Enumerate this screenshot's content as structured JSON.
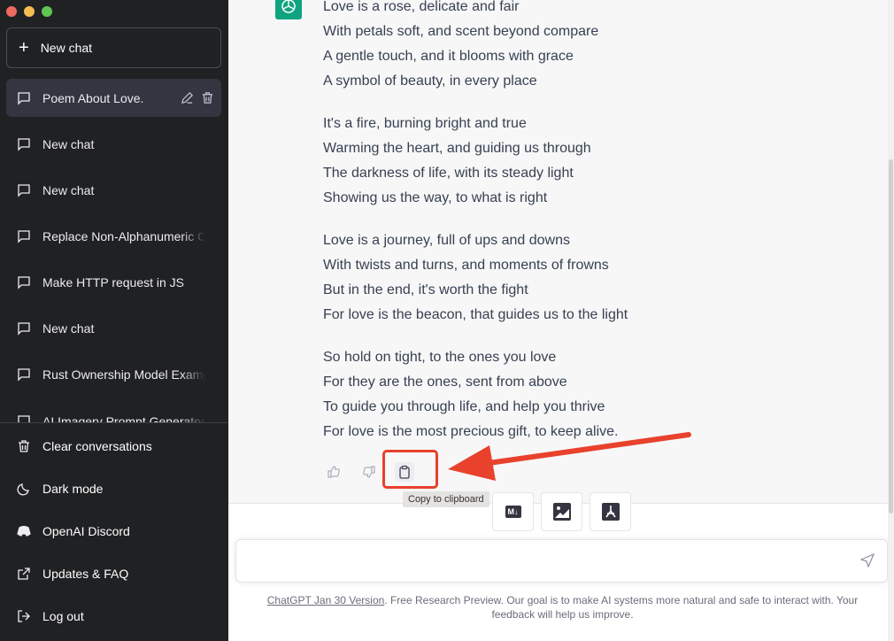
{
  "sidebar": {
    "new_chat": "New chat",
    "conversations": [
      {
        "label": "Poem About Love.",
        "active": true
      },
      {
        "label": "New chat"
      },
      {
        "label": "New chat"
      },
      {
        "label": "Replace Non-Alphanumeric Characters"
      },
      {
        "label": "Make HTTP request in JS"
      },
      {
        "label": "New chat"
      },
      {
        "label": "Rust Ownership Model Example"
      },
      {
        "label": "AI Imagery Prompt Generator"
      }
    ],
    "bottom": [
      {
        "label": "Clear conversations",
        "icon": "trash-icon"
      },
      {
        "label": "Dark mode",
        "icon": "moon-icon"
      },
      {
        "label": "OpenAI Discord",
        "icon": "discord-icon"
      },
      {
        "label": "Updates & FAQ",
        "icon": "external-link-icon"
      },
      {
        "label": "Log out",
        "icon": "logout-icon"
      }
    ]
  },
  "message": {
    "stanzas": [
      [
        "Love is a rose, delicate and fair",
        "With petals soft, and scent beyond compare",
        "A gentle touch, and it blooms with grace",
        "A symbol of beauty, in every place"
      ],
      [
        "It's a fire, burning bright and true",
        "Warming the heart, and guiding us through",
        "The darkness of life, with its steady light",
        "Showing us the way, to what is right"
      ],
      [
        "Love is a journey, full of ups and downs",
        "With twists and turns, and moments of frowns",
        "But in the end, it's worth the fight",
        "For love is the beacon, that guides us to the light"
      ],
      [
        "So hold on tight, to the ones you love",
        "For they are the ones, sent from above",
        "To guide you through life, and help you thrive",
        "For love is the most precious gift, to keep alive."
      ]
    ],
    "tooltip": "Copy to clipboard"
  },
  "export": {
    "markdown": "M↓"
  },
  "input": {
    "value": "",
    "placeholder": ""
  },
  "footer": {
    "link": "ChatGPT Jan 30 Version",
    "text": ". Free Research Preview. Our goal is to make AI systems more natural and safe to interact with. Your feedback will help us improve."
  },
  "colors": {
    "sidebar": "#202123",
    "active": "#343541",
    "accent": "#10a37f",
    "annotation": "#e8412c"
  }
}
